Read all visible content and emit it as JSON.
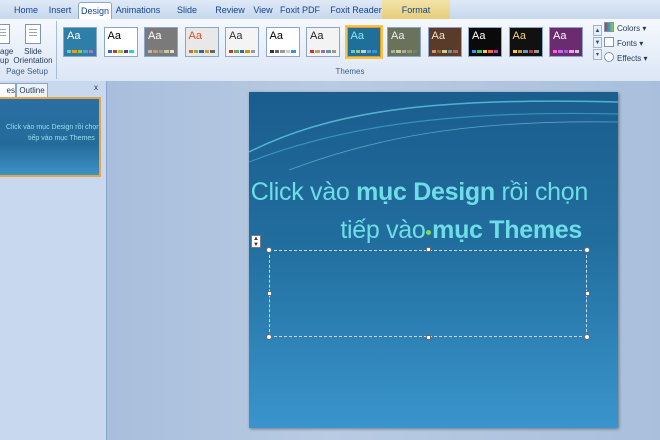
{
  "tabs": [
    {
      "label": "Home"
    },
    {
      "label": "Insert"
    },
    {
      "label": "Design"
    },
    {
      "label": "Animations"
    },
    {
      "label": "Slide Show"
    },
    {
      "label": "Review"
    },
    {
      "label": "View"
    },
    {
      "label": "Foxit PDF"
    },
    {
      "label": "Foxit Reader PDF"
    },
    {
      "label": "Format"
    }
  ],
  "active_tab": "Design",
  "ribbon": {
    "page_setup": {
      "setup_label": "Page Setup",
      "setup_partial_line1": "age",
      "setup_partial_line2": "up",
      "orientation_line1": "Slide",
      "orientation_line2": "Orientation",
      "group_label": "Page Setup"
    },
    "themes": {
      "group_label": "Themes",
      "sample_text": "Aa",
      "items": [
        {
          "bg": "#2d7fa8",
          "fg": "#ffffff",
          "dots": [
            "#6cc",
            "#f90",
            "#9c3",
            "#69c",
            "#c6c"
          ]
        },
        {
          "bg": "#ffffff",
          "fg": "#000000",
          "dots": [
            "#36c",
            "#c33",
            "#9c3",
            "#639",
            "#3cc"
          ]
        },
        {
          "bg": "#7a7a7a",
          "fg": "#ffffff",
          "dots": [
            "#bbb",
            "#c96",
            "#999",
            "#cc9",
            "#ddd"
          ]
        },
        {
          "bg": "#e8e8e8",
          "fg": "#d0522a",
          "dots": [
            "#c63",
            "#9a3",
            "#369",
            "#c93",
            "#666"
          ]
        },
        {
          "bg": "#f4f4f4",
          "fg": "#333333",
          "dots": [
            "#c33",
            "#6a6",
            "#36a",
            "#c90",
            "#999"
          ]
        },
        {
          "bg": "#ffffff",
          "fg": "#000000",
          "dots": [
            "#333",
            "#666",
            "#999",
            "#ccc",
            "#39c"
          ]
        },
        {
          "bg": "#f3f3f3",
          "fg": "#222222",
          "dots": [
            "#c33",
            "#c96",
            "#96c",
            "#699",
            "#999"
          ]
        },
        {
          "bg": "#1f6f9a",
          "fg": "#8ee6ef",
          "dots": [
            "#6cc",
            "#9c6",
            "#ccc",
            "#69c",
            "#39c"
          ]
        },
        {
          "bg": "#6b725c",
          "fg": "#eeeeee",
          "dots": [
            "#9b9",
            "#cc9",
            "#aaa",
            "#996",
            "#686"
          ]
        },
        {
          "bg": "#5a3b2a",
          "fg": "#f2e2c8",
          "dots": [
            "#c96",
            "#963",
            "#cc9",
            "#699",
            "#a66"
          ]
        },
        {
          "bg": "#0a0a0a",
          "fg": "#ffffff",
          "dots": [
            "#39f",
            "#3c6",
            "#fc3",
            "#f63",
            "#c3c"
          ]
        },
        {
          "bg": "#111111",
          "fg": "#f3d27a",
          "dots": [
            "#fc3",
            "#c93",
            "#69c",
            "#c33",
            "#999"
          ]
        },
        {
          "bg": "#6a2c6e",
          "fg": "#ffffff",
          "dots": [
            "#f6c",
            "#c6f",
            "#96c",
            "#f9f",
            "#ccc"
          ]
        }
      ]
    },
    "options": {
      "colors": "Colors",
      "fonts": "Fonts",
      "effects": "Effects"
    }
  },
  "left_panel": {
    "tab_slides_partial": "es",
    "tab_outline": "Outline",
    "close": "x",
    "thumb_line1": "Click vào mục Design rồi chọn",
    "thumb_line2": "tiếp vào mục Themes"
  },
  "slide": {
    "line1_regular": "Click vào ",
    "line1_bold": "mục Design",
    "line1_tail": " rồi chọn",
    "line2_regular": "tiếp vào ",
    "line2_bold": "mục Themes"
  },
  "colors": {
    "selection_outline": "#f2c350",
    "slide_text": "#6fdde8"
  }
}
